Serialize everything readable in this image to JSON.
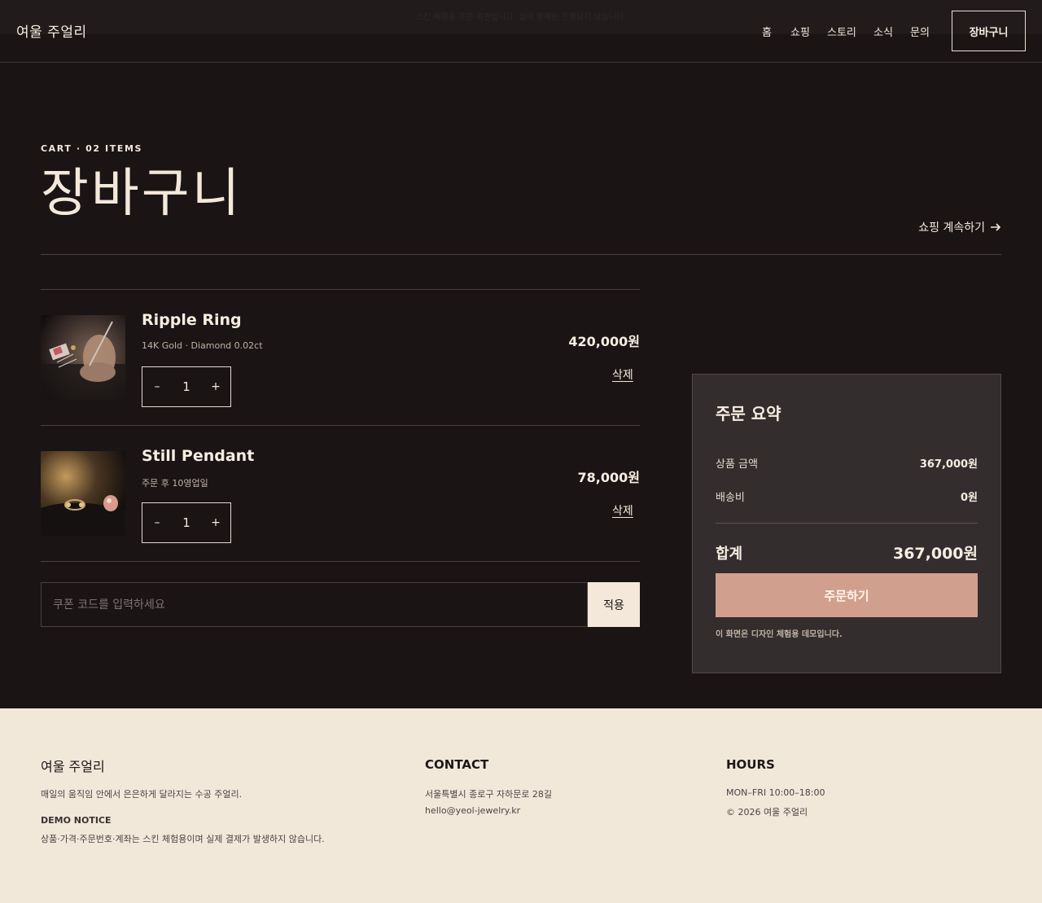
{
  "notice": {
    "text": "스킨 체험용 주문 화면입니다. 실제 결제는 진행되지 않습니다."
  },
  "header": {
    "logo": "여울 주얼리",
    "nav": [
      "홈",
      "쇼핑",
      "스토리",
      "소식",
      "문의"
    ],
    "cart_button": "장바구니"
  },
  "page": {
    "eyebrow": "CART · 02 ITEMS",
    "title": "장바구니",
    "continue_link": "쇼핑 계속하기",
    "continue_icon": "arrow-right-icon"
  },
  "cart": {
    "items": [
      {
        "name": "Ripple Ring",
        "meta": "14K Gold · Diamond 0.02ct",
        "qty_minus": "–",
        "quantity": "1",
        "qty_plus": "+",
        "price": "420,000원",
        "delete_label": "삭제"
      },
      {
        "name": "Still Pendant",
        "meta": "주문 후 10영업일",
        "qty_minus": "–",
        "quantity": "1",
        "qty_plus": "+",
        "price": "78,000원",
        "delete_label": "삭제"
      }
    ],
    "coupon": {
      "placeholder": "쿠폰 코드를 입력하세요",
      "value": "",
      "apply_label": "적용"
    }
  },
  "summary": {
    "title": "주문 요약",
    "subtotal_label": "상품 금액",
    "subtotal": "367,000원",
    "shipping_label": "배송비",
    "shipping": "0원",
    "total_label": "합계",
    "total": "367,000원",
    "order_button": "주문하기",
    "note": "이 화면은 디자인 체험용 데모입니다."
  },
  "footer": {
    "brand": "여울 주얼리",
    "tagline": "매일의 움직임 안에서 은은하게 달라지는 수공 주얼리.",
    "demo_heading": "DEMO NOTICE",
    "demo_text": "상품·가격·주문번호·계좌는 스킨 체험용이며 실제 결제가 발생하지 않습니다.",
    "contact_heading": "CONTACT",
    "address": "서울특별시 종로구 자하문로 28길",
    "email": "hello@yeol-jewelry.kr",
    "hours_heading": "HOURS",
    "hours": "MON–FRI 10:00–18:00",
    "copyright": "© 2026 여울 주얼리"
  },
  "colors": {
    "background": "#1a1415",
    "panel": "#332d2e",
    "accent": "#d19f8d",
    "cream": "#f2e8da"
  }
}
